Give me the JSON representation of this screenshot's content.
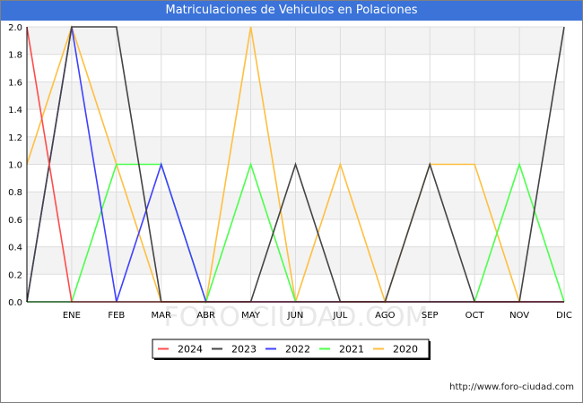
{
  "title": "Matriculaciones de Vehiculos en Polaciones",
  "footer_url": "http://www.foro-ciudad.com",
  "watermark": "FORO-CIUDAD.COM",
  "colors": {
    "title_bar": "#3b73d9",
    "grid": "#dddddd",
    "band": "#f3f3f3",
    "axis": "#000000"
  },
  "chart_data": {
    "type": "line",
    "title": "Matriculaciones de Vehiculos en Polaciones",
    "xlabel": "",
    "ylabel": "",
    "categories": [
      "",
      "ENE",
      "FEB",
      "MAR",
      "ABR",
      "MAY",
      "JUN",
      "JUL",
      "AGO",
      "SEP",
      "OCT",
      "NOV",
      "DIC"
    ],
    "ylim": [
      0,
      2.0
    ],
    "yticks": [
      "0.0",
      "0.2",
      "0.4",
      "0.6",
      "0.8",
      "1.0",
      "1.2",
      "1.4",
      "1.6",
      "1.8",
      "2.0"
    ],
    "grid": true,
    "legend_position": "bottom-center",
    "series": [
      {
        "name": "2024",
        "color": "#ff4c4c",
        "values": [
          2,
          0,
          0,
          0,
          0,
          0,
          0,
          0,
          0,
          0,
          0,
          0,
          0
        ]
      },
      {
        "name": "2023",
        "color": "#444444",
        "values": [
          0,
          2,
          2,
          0,
          0,
          0,
          1,
          0,
          0,
          1,
          0,
          0,
          2
        ]
      },
      {
        "name": "2022",
        "color": "#4040ff",
        "values": [
          0,
          2,
          0,
          1,
          0,
          0,
          0,
          0,
          0,
          0,
          0,
          0,
          0
        ]
      },
      {
        "name": "2021",
        "color": "#4cff4c",
        "values": [
          0,
          0,
          1,
          1,
          0,
          1,
          0,
          0,
          0,
          0,
          0,
          1,
          0
        ]
      },
      {
        "name": "2020",
        "color": "#ffbf40",
        "values": [
          1,
          2,
          1,
          0,
          0,
          2,
          0,
          1,
          0,
          1,
          1,
          0,
          0
        ]
      }
    ]
  }
}
